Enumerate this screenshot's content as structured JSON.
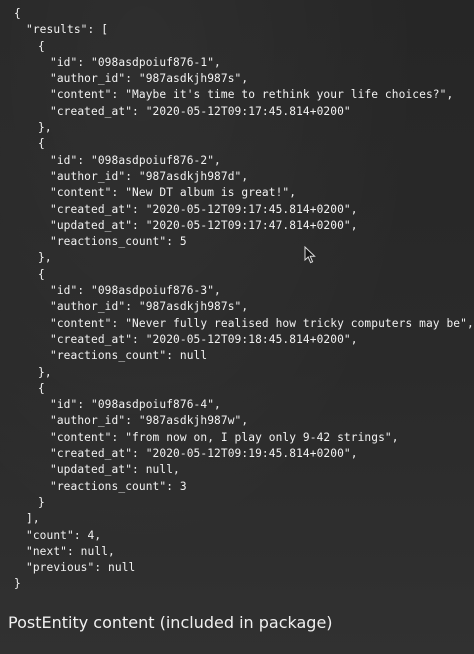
{
  "json_view": {
    "lines": [
      {
        "indent": "l0",
        "text": "{"
      },
      {
        "indent": "l1",
        "text": "\"results\": ["
      },
      {
        "indent": "l2",
        "text": "{"
      },
      {
        "indent": "l3",
        "text": "\"id\": \"098asdpoiuf876-1\","
      },
      {
        "indent": "l3",
        "text": "\"author_id\": \"987asdkjh987s\","
      },
      {
        "indent": "l3",
        "text": "\"content\": \"Maybe it's time to rethink your life choices?\","
      },
      {
        "indent": "l3",
        "text": "\"created_at\": \"2020-05-12T09:17:45.814+0200\""
      },
      {
        "indent": "l2",
        "text": "},"
      },
      {
        "indent": "l2",
        "text": "{"
      },
      {
        "indent": "l3",
        "text": "\"id\": \"098asdpoiuf876-2\","
      },
      {
        "indent": "l3",
        "text": "\"author_id\": \"987asdkjh987d\","
      },
      {
        "indent": "l3",
        "text": "\"content\": \"New DT album is great!\","
      },
      {
        "indent": "l3",
        "text": "\"created_at\": \"2020-05-12T09:17:45.814+0200\","
      },
      {
        "indent": "l3",
        "text": "\"updated_at\": \"2020-05-12T09:17:47.814+0200\","
      },
      {
        "indent": "l3",
        "text": "\"reactions_count\": 5"
      },
      {
        "indent": "l2",
        "text": "},"
      },
      {
        "indent": "l2",
        "text": "{"
      },
      {
        "indent": "l3",
        "text": "\"id\": \"098asdpoiuf876-3\","
      },
      {
        "indent": "l3",
        "text": "\"author_id\": \"987asdkjh987s\","
      },
      {
        "indent": "l3",
        "text": "\"content\": \"Never fully realised how tricky computers may be\","
      },
      {
        "indent": "l3",
        "text": "\"created_at\": \"2020-05-12T09:18:45.814+0200\","
      },
      {
        "indent": "l3",
        "text": "\"reactions_count\": null"
      },
      {
        "indent": "l2",
        "text": "},"
      },
      {
        "indent": "l2",
        "text": "{"
      },
      {
        "indent": "l3",
        "text": "\"id\": \"098asdpoiuf876-4\","
      },
      {
        "indent": "l3",
        "text": "\"author_id\": \"987asdkjh987w\","
      },
      {
        "indent": "l3",
        "text": "\"content\": \"from now on, I play only 9-42 strings\","
      },
      {
        "indent": "l3",
        "text": "\"created_at\": \"2020-05-12T09:19:45.814+0200\","
      },
      {
        "indent": "l3",
        "text": "\"updated_at\": null,"
      },
      {
        "indent": "l3",
        "text": "\"reactions_count\": 3"
      },
      {
        "indent": "l2",
        "text": "}"
      },
      {
        "indent": "l1",
        "text": "],"
      },
      {
        "indent": "l1",
        "text": "\"count\": 4,"
      },
      {
        "indent": "l1",
        "text": "\"next\": null,"
      },
      {
        "indent": "l1",
        "text": "\"previous\": null"
      },
      {
        "indent": "l0",
        "text": "}"
      }
    ]
  },
  "caption": {
    "text": "PostEntity content (included in package)"
  },
  "cursor": {
    "icon": "mouse-pointer-icon"
  }
}
